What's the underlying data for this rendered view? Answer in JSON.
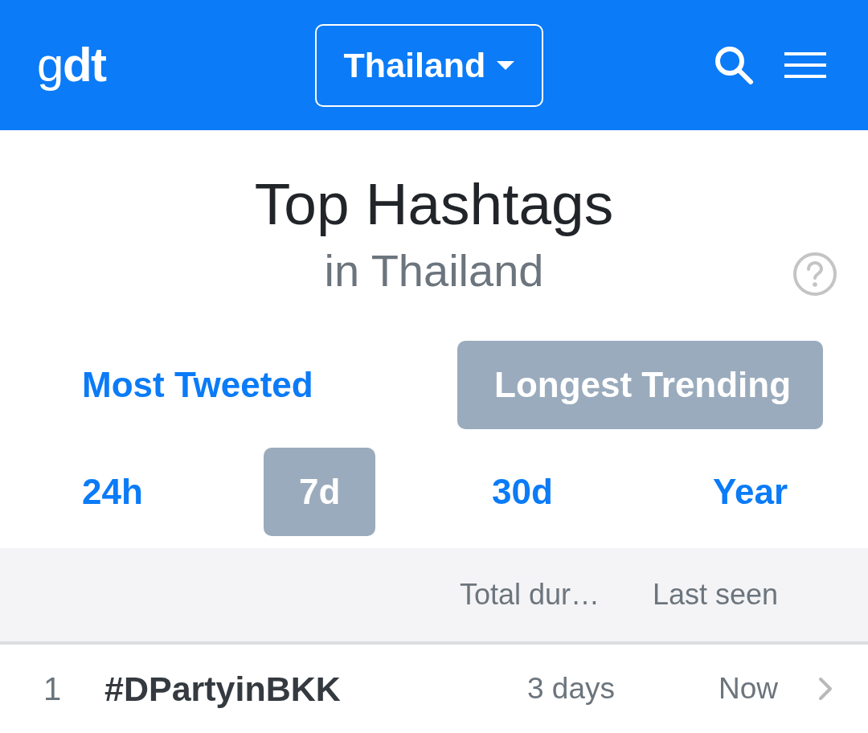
{
  "header": {
    "logo": "g**dt**",
    "country_button": "Thailand"
  },
  "heading": {
    "title": "Top Hashtags",
    "subtitle": "in Thailand"
  },
  "mode_tabs": [
    {
      "label": "Most Tweeted",
      "selected": false
    },
    {
      "label": "Longest Trending",
      "selected": true
    }
  ],
  "period_tabs": [
    {
      "label": "24h",
      "selected": false
    },
    {
      "label": "7d",
      "selected": true
    },
    {
      "label": "30d",
      "selected": false
    },
    {
      "label": "Year",
      "selected": false
    }
  ],
  "table": {
    "columns": [
      "Total dur…",
      "Last seen"
    ],
    "rows": [
      {
        "rank": "1",
        "hashtag": "#DPartyinBKK",
        "total_duration": "3 days",
        "last_seen": "Now"
      }
    ]
  }
}
